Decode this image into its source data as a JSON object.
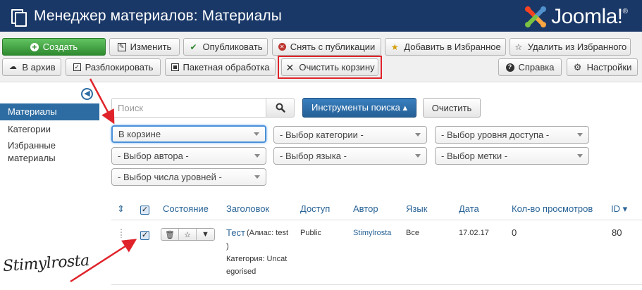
{
  "header": {
    "title": "Менеджер материалов: Материалы",
    "logo_text": "Joomla!",
    "logo_reg": "®"
  },
  "toolbar": {
    "row1": [
      {
        "label": "Создать",
        "icon": "plus-circle-icon"
      },
      {
        "label": "Изменить",
        "icon": "edit-icon"
      },
      {
        "label": "Опубликовать",
        "icon": "check-icon"
      },
      {
        "label": "Снять с публикации",
        "icon": "unpublish-icon"
      },
      {
        "label": "Добавить в Избранное",
        "icon": "star-filled-icon"
      },
      {
        "label": "Удалить из Избранного",
        "icon": "star-empty-icon"
      }
    ],
    "row2": [
      {
        "label": "В архив",
        "icon": "archive-icon"
      },
      {
        "label": "Разблокировать",
        "icon": "checkbox-icon"
      },
      {
        "label": "Пакетная обработка",
        "icon": "batch-icon"
      },
      {
        "label": "Очистить корзину",
        "icon": "x-icon"
      },
      {
        "label": "Справка",
        "icon": "help-icon"
      },
      {
        "label": "Настройки",
        "icon": "gear-icon"
      }
    ],
    "highlight_color": "#e0232a"
  },
  "sidebar": {
    "items": [
      {
        "label": "Материалы",
        "active": true
      },
      {
        "label": "Категории",
        "active": false
      },
      {
        "label": "Избранные материалы",
        "active": false
      }
    ]
  },
  "search": {
    "placeholder": "Поиск",
    "tools_label": "Инструменты поиска ▴",
    "clear_label": "Очистить"
  },
  "filters": {
    "status": "В корзине",
    "category": "- Выбор категории -",
    "access": "- Выбор уровня доступа -",
    "author": "- Выбор автора -",
    "language": "- Выбор языка -",
    "tag": "- Выбор метки -",
    "levels": "- Выбор числа уровней -"
  },
  "table": {
    "headers": {
      "sort": "⇕",
      "status": "Состояние",
      "title": "Заголовок",
      "access": "Доступ",
      "author": "Автор",
      "language": "Язык",
      "date": "Дата",
      "hits": "Кол-во просмотров",
      "id": "ID ▾"
    },
    "rows": [
      {
        "title": "Тест",
        "alias_line1": "(Алиас: test",
        "alias_line2": ")",
        "category_line1": "Категория: Uncat",
        "category_line2": "egorised",
        "access": "Public",
        "author": "Stimylrosta",
        "language": "Все",
        "date": "17.02.17",
        "hits": "0",
        "id": "80"
      }
    ]
  },
  "watermark": "Stimylrosta",
  "colors": {
    "header_bg": "#1a3867",
    "accent": "#2d6ca2",
    "success": "#46a546",
    "arrow": "#e0232a"
  }
}
